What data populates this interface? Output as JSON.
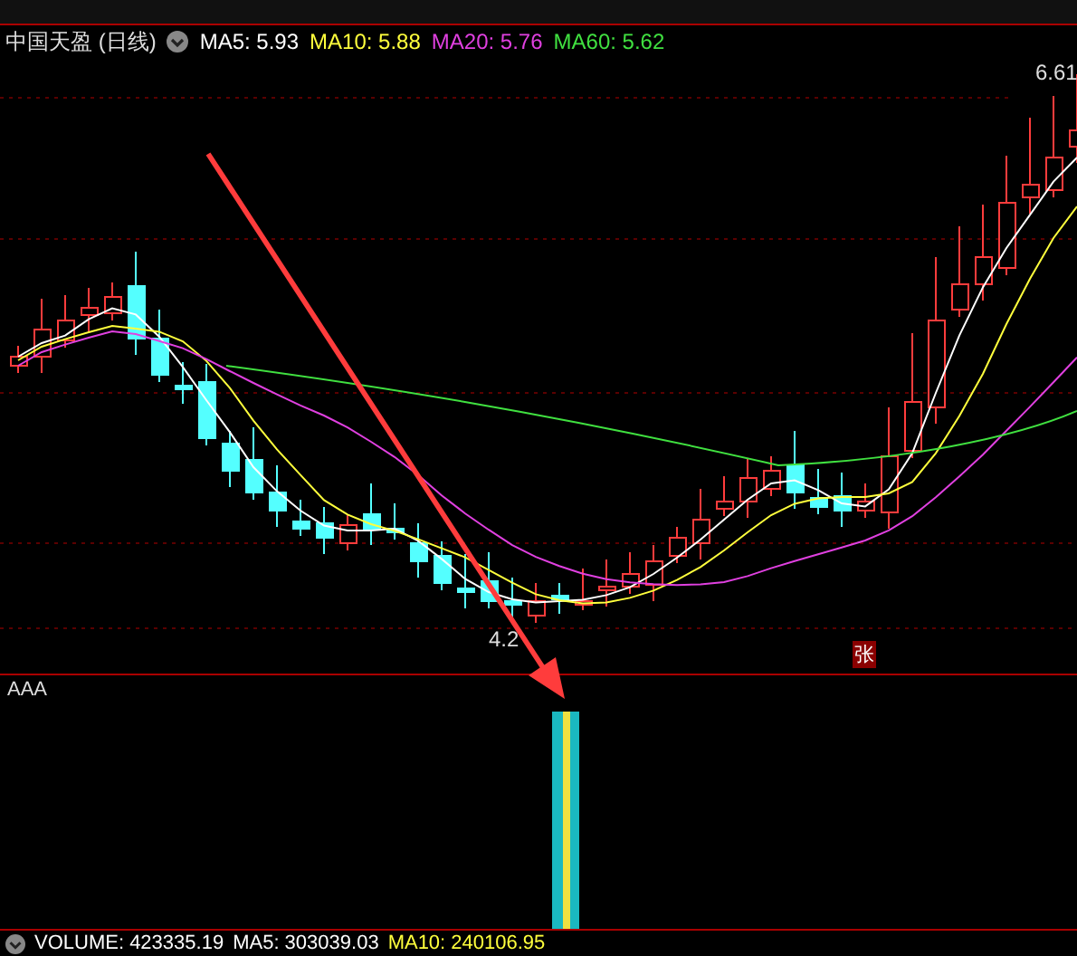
{
  "stock": {
    "title": "中国天盈 (日线)"
  },
  "ma_legend": [
    {
      "label": "MA5: 5.93",
      "color": "#ffffff"
    },
    {
      "label": "MA10: 5.88",
      "color": "#ffff3c"
    },
    {
      "label": "MA20: 5.76",
      "color": "#e040e0"
    },
    {
      "label": "MA60: 5.62",
      "color": "#40e040"
    }
  ],
  "price_chart": {
    "high_label": "6.61",
    "low_label": "4.2",
    "signal_badge": "张"
  },
  "indicator": {
    "name": "AAA"
  },
  "volume_legend": [
    {
      "label": "VOLUME: 423335.19",
      "color": "#ffffff"
    },
    {
      "label": "MA5: 303039.03",
      "color": "#ffffff"
    },
    {
      "label": "MA10: 240106.95",
      "color": "#ffff3c"
    }
  ]
}
